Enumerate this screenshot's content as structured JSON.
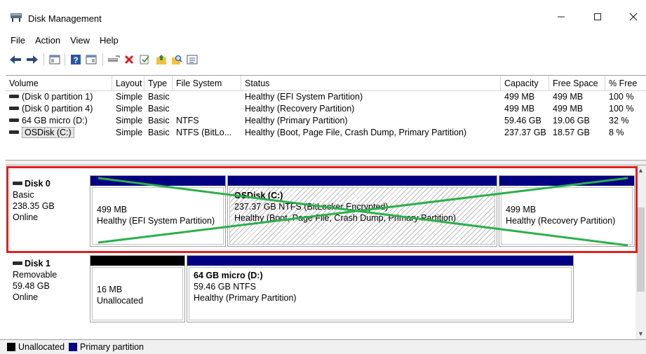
{
  "window": {
    "title": "Disk Management"
  },
  "menu": [
    "File",
    "Action",
    "View",
    "Help"
  ],
  "toolbar": [
    "back-icon",
    "forward-icon",
    "console-tree-icon",
    "help-icon",
    "show-hide-icon",
    "connect-icon",
    "delete-icon",
    "check-icon",
    "up-folder-icon",
    "search-icon",
    "properties-icon"
  ],
  "table": {
    "headers": [
      "Volume",
      "Layout",
      "Type",
      "File System",
      "Status",
      "Capacity",
      "Free Space",
      "% Free"
    ],
    "rows": [
      [
        "(Disk 0 partition 1)",
        "Simple",
        "Basic",
        "",
        "Healthy (EFI System Partition)",
        "499 MB",
        "499 MB",
        "100 %"
      ],
      [
        "(Disk 0 partition 4)",
        "Simple",
        "Basic",
        "",
        "Healthy (Recovery Partition)",
        "499 MB",
        "499 MB",
        "100 %"
      ],
      [
        "64 GB micro (D:)",
        "Simple",
        "Basic",
        "NTFS",
        "Healthy (Primary Partition)",
        "59.46 GB",
        "19.06 GB",
        "32 %"
      ],
      [
        "OSDisk (C:)",
        "Simple",
        "Basic",
        "NTFS (BitLo...",
        "Healthy (Boot, Page File, Crash Dump, Primary Partition)",
        "237.37 GB",
        "18.57 GB",
        "8 %"
      ]
    ]
  },
  "disk0": {
    "name": "Disk 0",
    "type": "Basic",
    "size": "238.35 GB",
    "status": "Online",
    "p1": {
      "size": "499 MB",
      "status": "Healthy (EFI System Partition)"
    },
    "p2": {
      "name": "OSDisk (C:)",
      "size": "237.37 GB NTFS (BitLocker Encrypted)",
      "status": "Healthy (Boot, Page File, Crash Dump, Primary Partition)"
    },
    "p3": {
      "size": "499 MB",
      "status": "Healthy (Recovery Partition)"
    }
  },
  "disk1": {
    "name": "Disk 1",
    "type": "Removable",
    "size": "59.48 GB",
    "status": "Online",
    "p1": {
      "size": "16 MB",
      "status": "Unallocated"
    },
    "p2": {
      "name": "64 GB micro (D:)",
      "size": "59.46 GB NTFS",
      "status": "Healthy (Primary Partition)"
    }
  },
  "legend": {
    "unallocated": "Unallocated",
    "primary": "Primary partition"
  },
  "colors": {
    "primary": "#000080",
    "unallocated": "#000000",
    "highlight": "#e02020",
    "cross": "#2ab04a"
  }
}
